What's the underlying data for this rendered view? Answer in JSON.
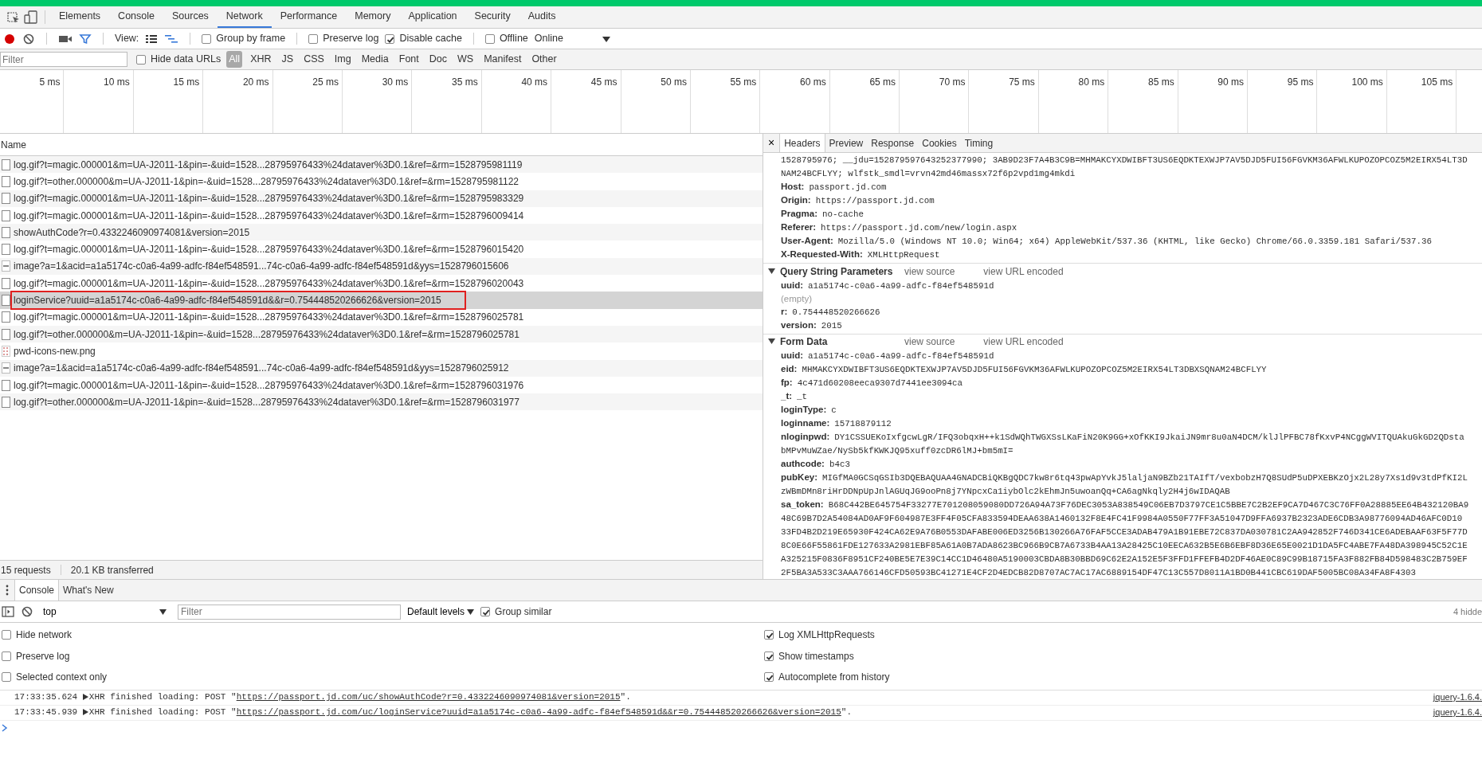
{
  "main_tabs": [
    {
      "label": "Elements",
      "selected": false
    },
    {
      "label": "Console",
      "selected": false
    },
    {
      "label": "Sources",
      "selected": false
    },
    {
      "label": "Network",
      "selected": true
    },
    {
      "label": "Performance",
      "selected": false
    },
    {
      "label": "Memory",
      "selected": false
    },
    {
      "label": "Application",
      "selected": false
    },
    {
      "label": "Security",
      "selected": false
    },
    {
      "label": "Audits",
      "selected": false
    }
  ],
  "network_toolbar": {
    "recording": true,
    "view_label": "View:",
    "checkboxes": [
      {
        "label": "Group by frame",
        "checked": false
      },
      {
        "label": "Preserve log",
        "checked": false
      },
      {
        "label": "Disable cache",
        "checked": true
      },
      {
        "label": "Offline",
        "checked": false
      }
    ],
    "throttling": "Online"
  },
  "filter_bar": {
    "placeholder": "Filter",
    "hide_data_urls": {
      "label": "Hide data URLs",
      "checked": false
    },
    "types": [
      {
        "label": "All",
        "selected": true
      },
      {
        "label": "XHR",
        "selected": false
      },
      {
        "label": "JS",
        "selected": false
      },
      {
        "label": "CSS",
        "selected": false
      },
      {
        "label": "Img",
        "selected": false
      },
      {
        "label": "Media",
        "selected": false
      },
      {
        "label": "Font",
        "selected": false
      },
      {
        "label": "Doc",
        "selected": false
      },
      {
        "label": "WS",
        "selected": false
      },
      {
        "label": "Manifest",
        "selected": false
      },
      {
        "label": "Other",
        "selected": false
      }
    ]
  },
  "timeline": {
    "ticks": [
      "5 ms",
      "10 ms",
      "15 ms",
      "20 ms",
      "25 ms",
      "30 ms",
      "35 ms",
      "40 ms",
      "45 ms",
      "50 ms",
      "55 ms",
      "60 ms",
      "65 ms",
      "70 ms",
      "75 ms",
      "80 ms",
      "85 ms",
      "90 ms",
      "95 ms",
      "100 ms",
      "105 ms"
    ]
  },
  "requests": {
    "column": "Name",
    "rows": [
      {
        "name": "log.gif?t=magic.000001&m=UA-J2011-1&pin=-&uid=1528...28795976433%24dataver%3D0.1&ref=&rm=1528795981119",
        "kind": "document",
        "selected": false,
        "outlined": false
      },
      {
        "name": "log.gif?t=other.000000&m=UA-J2011-1&pin=-&uid=1528...28795976433%24dataver%3D0.1&ref=&rm=1528795981122",
        "kind": "document",
        "selected": false,
        "outlined": false
      },
      {
        "name": "log.gif?t=magic.000001&m=UA-J2011-1&pin=-&uid=1528...28795976433%24dataver%3D0.1&ref=&rm=1528795983329",
        "kind": "document",
        "selected": false,
        "outlined": false
      },
      {
        "name": "log.gif?t=magic.000001&m=UA-J2011-1&pin=-&uid=1528...28795976433%24dataver%3D0.1&ref=&rm=1528796009414",
        "kind": "document",
        "selected": false,
        "outlined": false
      },
      {
        "name": "showAuthCode?r=0.4332246090974081&version=2015",
        "kind": "document",
        "selected": false,
        "outlined": false
      },
      {
        "name": "log.gif?t=magic.000001&m=UA-J2011-1&pin=-&uid=1528...28795976433%24dataver%3D0.1&ref=&rm=1528796015420",
        "kind": "document",
        "selected": false,
        "outlined": false
      },
      {
        "name": "image?a=1&acid=a1a5174c-c0a6-4a99-adfc-f84ef548591...74c-c0a6-4a99-adfc-f84ef548591d&yys=1528796015606",
        "kind": "image",
        "selected": false,
        "outlined": false
      },
      {
        "name": "log.gif?t=magic.000001&m=UA-J2011-1&pin=-&uid=1528...28795976433%24dataver%3D0.1&ref=&rm=1528796020043",
        "kind": "document",
        "selected": false,
        "outlined": false
      },
      {
        "name": "loginService?uuid=a1a5174c-c0a6-4a99-adfc-f84ef548591d&&r=0.754448520266626&version=2015",
        "kind": "document",
        "selected": true,
        "outlined": true
      },
      {
        "name": "log.gif?t=magic.000001&m=UA-J2011-1&pin=-&uid=1528...28795976433%24dataver%3D0.1&ref=&rm=1528796025781",
        "kind": "document",
        "selected": false,
        "outlined": false
      },
      {
        "name": "log.gif?t=other.000000&m=UA-J2011-1&pin=-&uid=1528...28795976433%24dataver%3D0.1&ref=&rm=1528796025781",
        "kind": "document",
        "selected": false,
        "outlined": false
      },
      {
        "name": "pwd-icons-new.png",
        "kind": "sprite",
        "selected": false,
        "outlined": false
      },
      {
        "name": "image?a=1&acid=a1a5174c-c0a6-4a99-adfc-f84ef548591...74c-c0a6-4a99-adfc-f84ef548591d&yys=1528796025912",
        "kind": "image",
        "selected": false,
        "outlined": false
      },
      {
        "name": "log.gif?t=magic.000001&m=UA-J2011-1&pin=-&uid=1528...28795976433%24dataver%3D0.1&ref=&rm=1528796031976",
        "kind": "document",
        "selected": false,
        "outlined": false
      },
      {
        "name": "log.gif?t=other.000000&m=UA-J2011-1&pin=-&uid=1528...28795976433%24dataver%3D0.1&ref=&rm=1528796031977",
        "kind": "document",
        "selected": false,
        "outlined": false
      }
    ]
  },
  "status": {
    "requests": "15 requests",
    "transferred": "20.1 KB transferred"
  },
  "details": {
    "close": "×",
    "tabs": [
      {
        "label": "Headers",
        "selected": true
      },
      {
        "label": "Preview",
        "selected": false
      },
      {
        "label": "Response",
        "selected": false
      },
      {
        "label": "Cookies",
        "selected": false
      },
      {
        "label": "Timing",
        "selected": false
      }
    ],
    "header_lines": [
      {
        "kind": "continuation",
        "lines": [
          "1528795976; __jdu=152879597643252377990; 3AB9D23F7A4B3C9B=MHMAKCYXDWIBFT3US6EQDKTEXWJP7AV5DJD5FUI56FGVKM36AFWLKUPOZOPCOZ5M2EIRX54LT3D"
        ]
      },
      {
        "kind": "continuation",
        "lines": [
          "NAM24BCFLYY; wlfstk_smdl=vrvn42md46massx72f6p2vpd1mg4mkdi"
        ]
      },
      {
        "kind": "param",
        "name": "Host:",
        "lines": [
          "passport.jd.com"
        ]
      },
      {
        "kind": "param",
        "name": "Origin:",
        "lines": [
          "https://passport.jd.com"
        ]
      },
      {
        "kind": "param",
        "name": "Pragma:",
        "lines": [
          "no-cache"
        ]
      },
      {
        "kind": "param",
        "name": "Referer:",
        "lines": [
          "https://passport.jd.com/new/login.aspx"
        ]
      },
      {
        "kind": "param",
        "name": "User-Agent:",
        "lines": [
          "Mozilla/5.0 (Windows NT 10.0; Win64; x64) AppleWebKit/537.36 (KHTML, like Gecko) Chrome/66.0.3359.181 Safari/537.36"
        ]
      },
      {
        "kind": "param",
        "name": "X-Requested-With:",
        "lines": [
          "XMLHttpRequest"
        ]
      }
    ],
    "sections": [
      {
        "title": "Query String Parameters",
        "expanded": true,
        "links": [
          "view source",
          "view URL encoded"
        ],
        "params": [
          {
            "kind": "param",
            "name": "uuid:",
            "lines": [
              "a1a5174c-c0a6-4a99-adfc-f84ef548591d"
            ]
          },
          {
            "kind": "empty",
            "lines": [
              "(empty)"
            ]
          },
          {
            "kind": "param",
            "name": "r:",
            "lines": [
              "0.754448520266626"
            ]
          },
          {
            "kind": "param",
            "name": "version:",
            "lines": [
              "2015"
            ]
          }
        ]
      },
      {
        "title": "Form Data",
        "expanded": true,
        "links": [
          "view source",
          "view URL encoded"
        ],
        "params": [
          {
            "kind": "param",
            "name": "uuid:",
            "lines": [
              "a1a5174c-c0a6-4a99-adfc-f84ef548591d"
            ]
          },
          {
            "kind": "param",
            "name": "eid:",
            "lines": [
              "MHMAKCYXDWIBFT3US6EQDKTEXWJP7AV5DJD5FUI56FGVKM36AFWLKUPOZOPCOZ5M2EIRX54LT3DBXSQNAM24BCFLYY"
            ]
          },
          {
            "kind": "param",
            "name": "fp:",
            "lines": [
              "4c471d60208eeca9307d7441ee3094ca"
            ]
          },
          {
            "kind": "param",
            "name": "_t:",
            "lines": [
              "_t"
            ]
          },
          {
            "kind": "param",
            "name": "loginType:",
            "lines": [
              "c"
            ]
          },
          {
            "kind": "param",
            "name": "loginname:",
            "lines": [
              "15718879112"
            ]
          },
          {
            "kind": "param",
            "name": "nloginpwd:",
            "lines": [
              "DY1CSSUEKoIxfgcwLgR/IFQ3obqxH++k1SdWQhTWGXSsLKaFiN20K9GG+xOfKKI9JkaiJN9mr8u0aN4DCM/klJlPFBC78fKxvP4NCggWVITQUAkuGkGD2QDsta",
              "bMPvMuWZae/NySb5kfKWKJQ95xuff0zcDR6lMJ+bm5mI="
            ]
          },
          {
            "kind": "param",
            "name": "authcode:",
            "lines": [
              "b4c3"
            ]
          },
          {
            "kind": "param",
            "name": "pubKey:",
            "lines": [
              "MIGfMA0GCSqGSIb3DQEBAQUAA4GNADCBiQKBgQDC7kw8r6tq43pwApYvkJ5laljaN9BZb21TAIfT/vexbobzH7Q8SUdP5uDPXEBKzOjx2L28y7Xs1d9v3tdPfKI2L",
              "zWBmDMn8riHrDDNpUpJnlAGUqJG9ooPn8j7YNpcxCa1iybOlc2kEhmJn5uwoanQq+CA6agNkqly2H4j6wIDAQAB"
            ]
          },
          {
            "kind": "param",
            "name": "sa_token:",
            "lines": [
              "B68C442BE645754F33277E701208059080DD726A94A73F76DEC3053A838549C06EB7D3797CE1C5BBE7C2B2EF9CA7D467C3C76FF0A28885EE64B432120BA9",
              "48C69B7D2A54084AD0AF9F604987E3FF4F05CFA833594DEAA638A1460132F8E4FC41F9984A0550F77FF3A51047D9FFA6937B2323ADE6CDB3A98776094AD46AFC0D10",
              "33FD4B2D219E65930F424CA62E9A76B0553DAFABE006ED3256B130266A76FAF5CCE3ADAB479A1B91EBE72C837DA030781C2AA942852F746D341CE6ADEBAAF63F5F77D",
              "8C0E66F55861FDE127633A2981EBF85A61A0B7ADA8623BC966B9CB7A6733B4AA13A28425C10EECA632B5E6B6EBF8D36E65E0021D1DA5FC4ABE7FA48DA398945C52C1E",
              "A325215F0836F8951CF240BE5E7E39C14CC1D46480A5190003CBDA8B30BBD69C62E2A152E5F3FFD1FFEFB4D2DF46AE0C89C99B18715FA3F882FB84D598483C2B759EF",
              "2F5BA3A533C3AAA766146CFD50593BC41271E4CF2D4EDCB82D8707AC7AC17AC6889154DF47C13C557D8011A1BD0B441CBC619DAF5005BC08A34FA8F4303"
            ]
          }
        ]
      }
    ]
  },
  "drawer": {
    "tabs": [
      {
        "label": "Console",
        "selected": true
      },
      {
        "label": "What's New",
        "selected": false
      }
    ],
    "context": "top",
    "filter_placeholder": "Filter",
    "levels": "Default levels",
    "group_similar": {
      "label": "Group similar",
      "checked": true
    },
    "hidden_count": "4 hidde",
    "settings_left": [
      {
        "label": "Hide network",
        "checked": false
      },
      {
        "label": "Preserve log",
        "checked": false
      },
      {
        "label": "Selected context only",
        "checked": false
      }
    ],
    "settings_right": [
      {
        "label": "Log XMLHttpRequests",
        "checked": true
      },
      {
        "label": "Show timestamps",
        "checked": true
      },
      {
        "label": "Autocomplete from history",
        "checked": true
      }
    ],
    "messages": [
      {
        "time": "17:33:35.624",
        "before": "XHR finished loading: POST \"",
        "url": "https://passport.jd.com/uc/showAuthCode?r=0.4332246090974081&version=2015",
        "after": "\".",
        "source": "jquery-1.6.4."
      },
      {
        "time": "17:33:45.939",
        "before": "XHR finished loading: POST \"",
        "url": "https://passport.jd.com/uc/loginService?uuid=a1a5174c-c0a6-4a99-adfc-f84ef548591d&&r=0.754448520266626&version=2015",
        "after": "\".",
        "source": "jquery-1.6.4."
      }
    ]
  }
}
